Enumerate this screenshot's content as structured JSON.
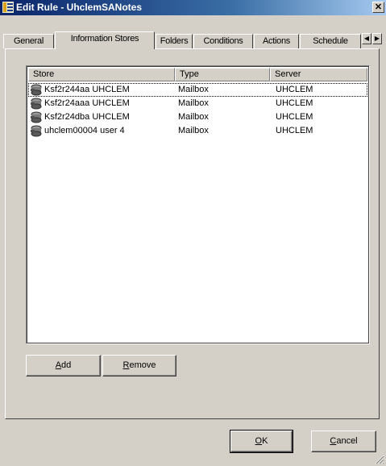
{
  "window": {
    "title": "Edit Rule - UhclemSANotes",
    "close_label": "✕"
  },
  "tabs": [
    {
      "label": "General"
    },
    {
      "label": "Information Stores"
    },
    {
      "label": "Folders"
    },
    {
      "label": "Conditions"
    },
    {
      "label": "Actions"
    },
    {
      "label": "Schedule"
    }
  ],
  "tab_scroll": {
    "left": "◀",
    "right": "▶"
  },
  "list": {
    "columns": [
      "Store",
      "Type",
      "Server"
    ],
    "rows": [
      {
        "store": "Ksf2r244aa UHCLEM",
        "type": "Mailbox",
        "server": "UHCLEM"
      },
      {
        "store": "Ksf2r24aaa UHCLEM",
        "type": "Mailbox",
        "server": "UHCLEM"
      },
      {
        "store": "Ksf2r24dba UHCLEM",
        "type": "Mailbox",
        "server": "UHCLEM"
      },
      {
        "store": "uhclem00004 user 4",
        "type": "Mailbox",
        "server": "UHCLEM"
      }
    ],
    "row_icon": "mailbox-store-icon"
  },
  "buttons": {
    "add": {
      "label": "Add",
      "mnemonic": "A"
    },
    "remove": {
      "label": "Remove",
      "mnemonic": "R"
    },
    "ok": {
      "label": "OK",
      "mnemonic": "O"
    },
    "cancel": {
      "label": "Cancel",
      "mnemonic": "C"
    }
  },
  "colors": {
    "face": "#d4d0c8",
    "title_start": "#0a246a",
    "title_end": "#a6caf0"
  }
}
